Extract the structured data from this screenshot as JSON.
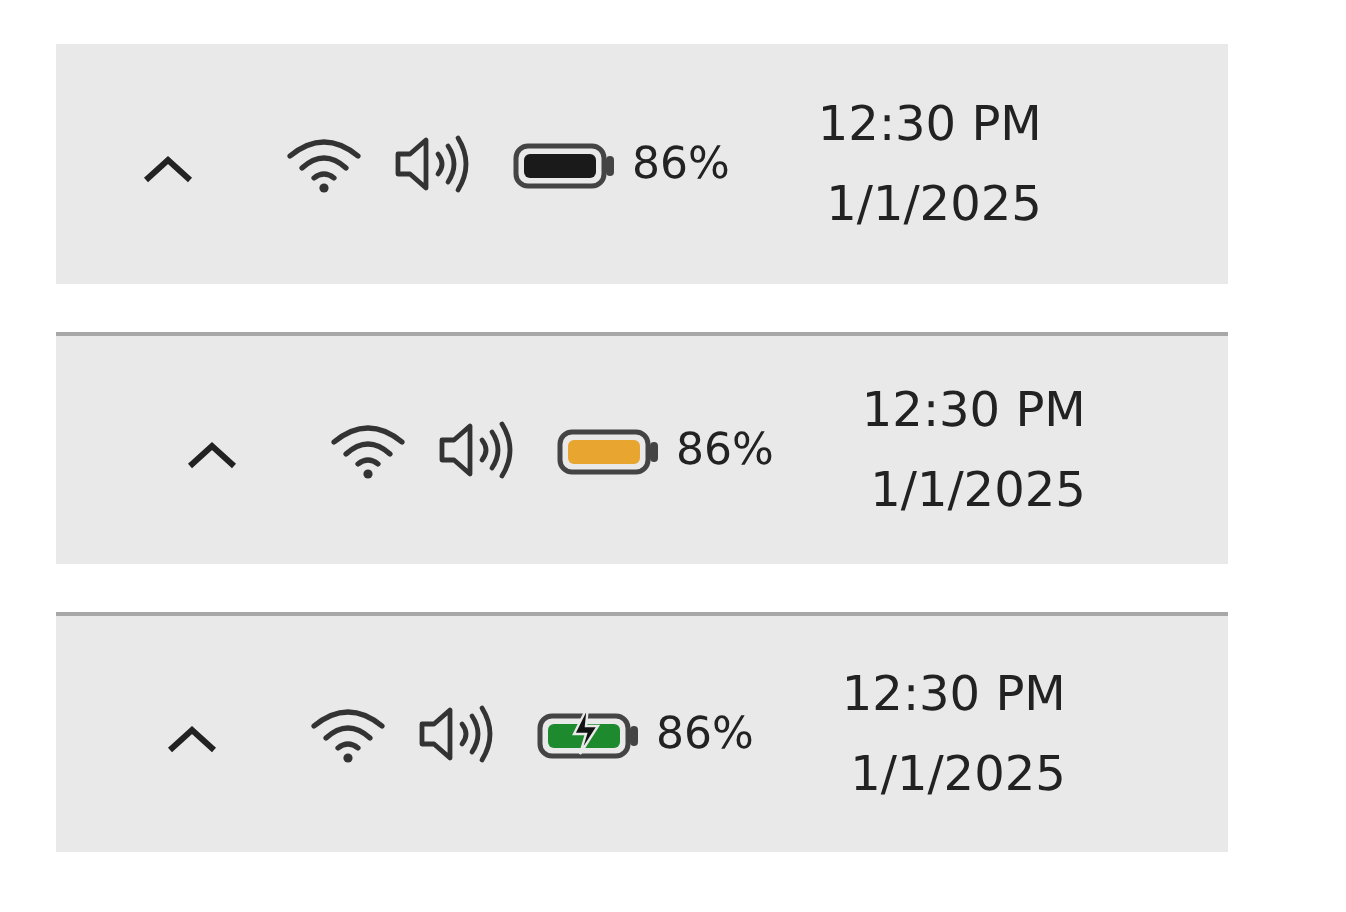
{
  "trays": [
    {
      "battery": {
        "kind": "normal",
        "color": "#1a1a1a"
      },
      "percent": "86%",
      "time": "12:30 PM",
      "date": "1/1/2025"
    },
    {
      "battery": {
        "kind": "saver",
        "color": "#e8a530"
      },
      "percent": "86%",
      "time": "12:30 PM",
      "date": "1/1/2025"
    },
    {
      "battery": {
        "kind": "charging",
        "color": "#1e8a2e"
      },
      "percent": "86%",
      "time": "12:30 PM",
      "date": "1/1/2025"
    }
  ]
}
